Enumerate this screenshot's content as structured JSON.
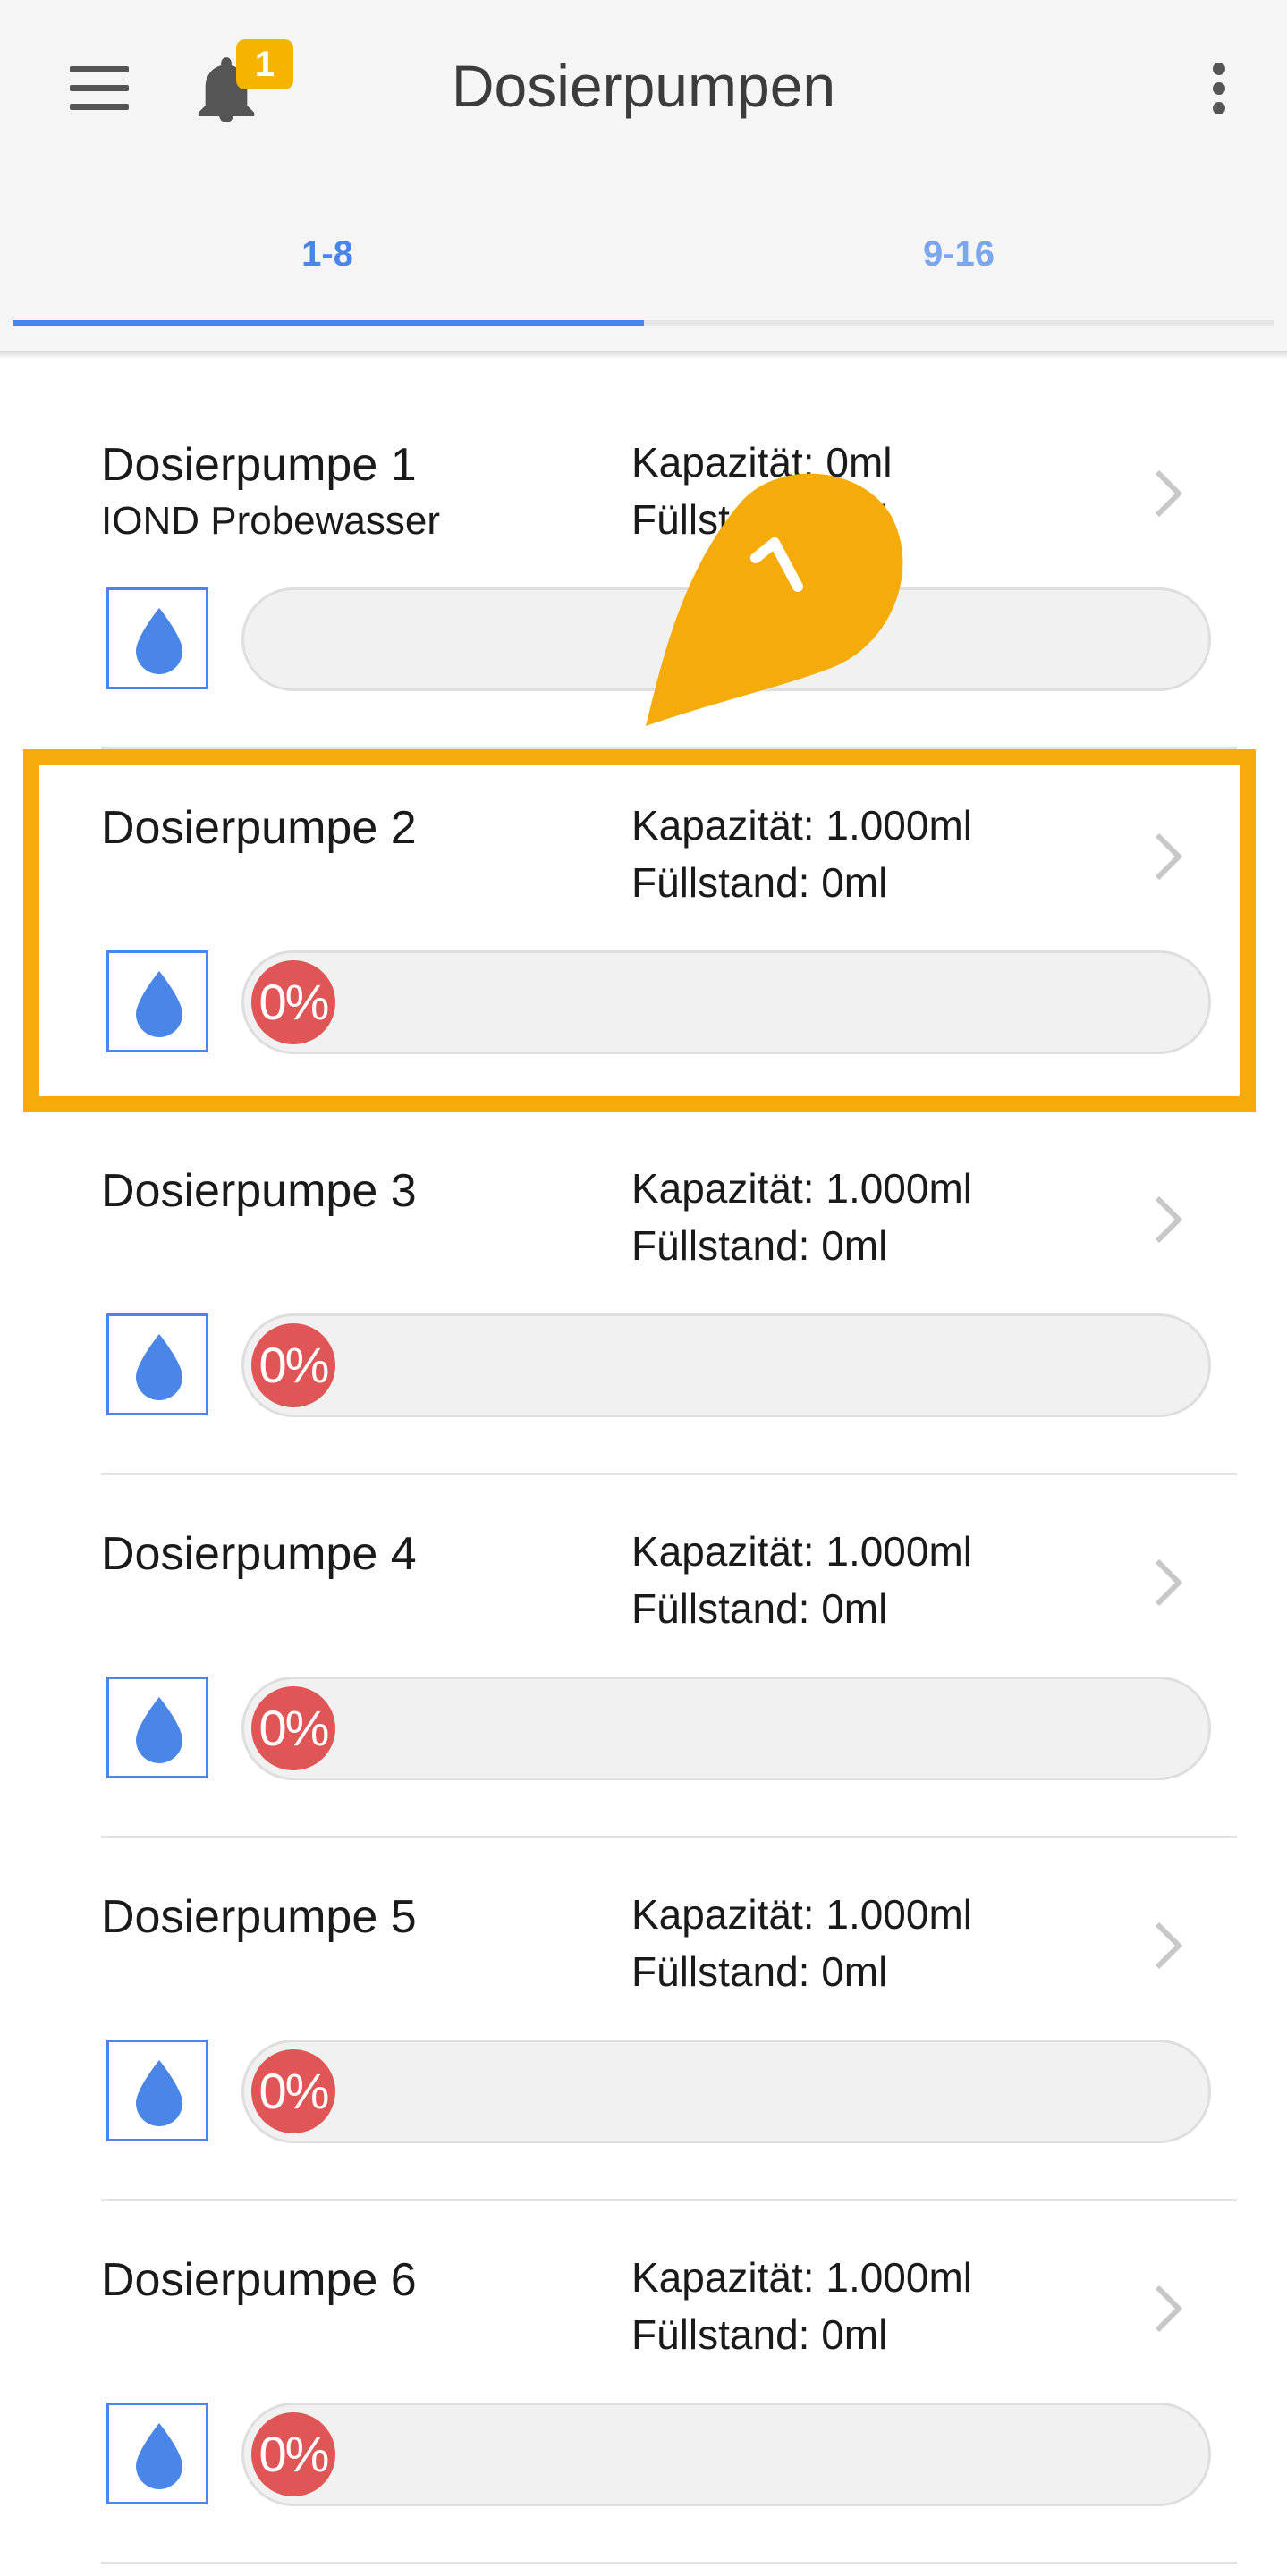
{
  "header": {
    "title": "Dosierpumpen",
    "notification_count": "1"
  },
  "tabs": [
    {
      "label": "1-8",
      "active": true
    },
    {
      "label": "9-16",
      "active": false
    }
  ],
  "pumps": [
    {
      "name": "Dosierpumpe 1",
      "subtitle": "IOND Probewasser",
      "capacity": "Kapazität: 0ml",
      "level": "Füllstand: 0ml",
      "percent": ""
    },
    {
      "name": "Dosierpumpe 2",
      "subtitle": "",
      "capacity": "Kapazität: 1.000ml",
      "level": "Füllstand: 0ml",
      "percent": "0%"
    },
    {
      "name": "Dosierpumpe 3",
      "subtitle": "",
      "capacity": "Kapazität: 1.000ml",
      "level": "Füllstand: 0ml",
      "percent": "0%"
    },
    {
      "name": "Dosierpumpe 4",
      "subtitle": "",
      "capacity": "Kapazität: 1.000ml",
      "level": "Füllstand: 0ml",
      "percent": "0%"
    },
    {
      "name": "Dosierpumpe 5",
      "subtitle": "",
      "capacity": "Kapazität: 1.000ml",
      "level": "Füllstand: 0ml",
      "percent": "0%"
    },
    {
      "name": "Dosierpumpe 6",
      "subtitle": "",
      "capacity": "Kapazität: 1.000ml",
      "level": "Füllstand: 0ml",
      "percent": "0%"
    }
  ],
  "annotation": {
    "marker_label": "1",
    "highlight_color": "#f5ac0a"
  },
  "colors": {
    "accent": "#4a86e8",
    "empty_level": "#e05555",
    "badge": "#f5b400"
  },
  "icons": [
    "menu-icon",
    "bell-icon",
    "more-vert-icon",
    "chevron-right-icon",
    "water-drop-icon"
  ]
}
